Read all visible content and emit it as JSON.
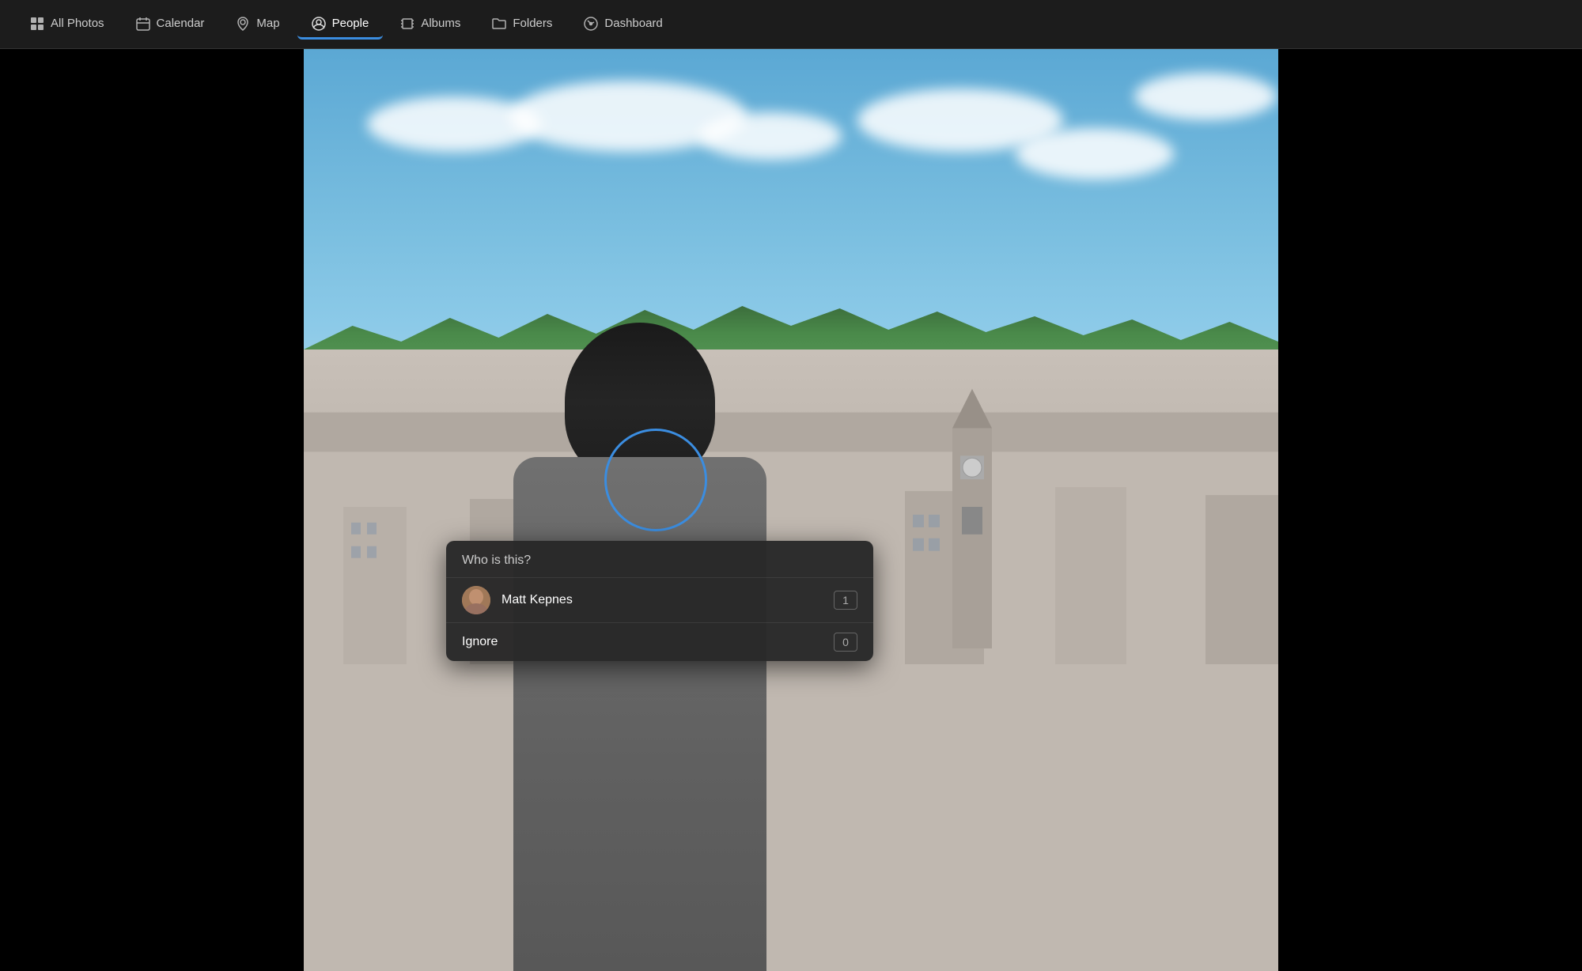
{
  "navbar": {
    "items": [
      {
        "id": "all-photos",
        "label": "All Photos",
        "icon": "grid",
        "active": false
      },
      {
        "id": "calendar",
        "label": "Calendar",
        "icon": "calendar",
        "active": false
      },
      {
        "id": "map",
        "label": "Map",
        "icon": "map-pin",
        "active": false
      },
      {
        "id": "people",
        "label": "People",
        "icon": "person-circle",
        "active": true
      },
      {
        "id": "albums",
        "label": "Albums",
        "icon": "albums",
        "active": false
      },
      {
        "id": "folders",
        "label": "Folders",
        "icon": "folder",
        "active": false
      },
      {
        "id": "dashboard",
        "label": "Dashboard",
        "icon": "dashboard",
        "active": false
      }
    ]
  },
  "who_popup": {
    "header": "Who is this?",
    "options": [
      {
        "name": "Matt Kepnes",
        "count": "1"
      },
      {
        "name": "Ignore",
        "count": "0"
      }
    ]
  },
  "colors": {
    "active_tab_border": "#3b8de0",
    "face_circle": "#3b8de0",
    "popup_bg": "rgba(40,40,40,0.97)"
  }
}
